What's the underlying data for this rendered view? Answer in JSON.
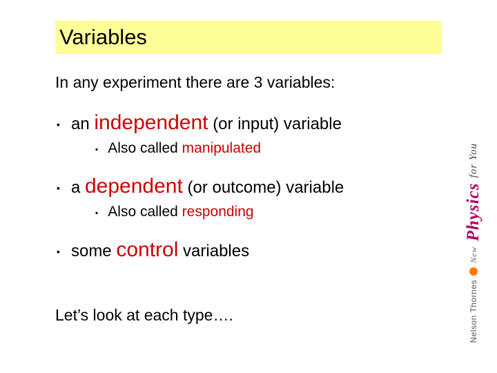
{
  "title": "Variables",
  "intro": "In any experiment there are 3 variables:",
  "items": [
    {
      "prefix": "an",
      "keyword": "independent",
      "suffix": "(or input) variable",
      "sub_prefix": "Also called",
      "sub_keyword": "manipulated"
    },
    {
      "prefix": "a",
      "keyword": "dependent",
      "suffix": "(or outcome) variable",
      "sub_prefix": "Also called",
      "sub_keyword": "responding"
    },
    {
      "prefix": "some",
      "keyword": "control",
      "suffix": "variables",
      "sub_prefix": "",
      "sub_keyword": ""
    }
  ],
  "closing": "Let’s look at each type….",
  "branding": {
    "new": "New",
    "physics": "Physics",
    "for_you": "for You",
    "publisher": "Nelson Thornes"
  },
  "bullet_char": "▪"
}
